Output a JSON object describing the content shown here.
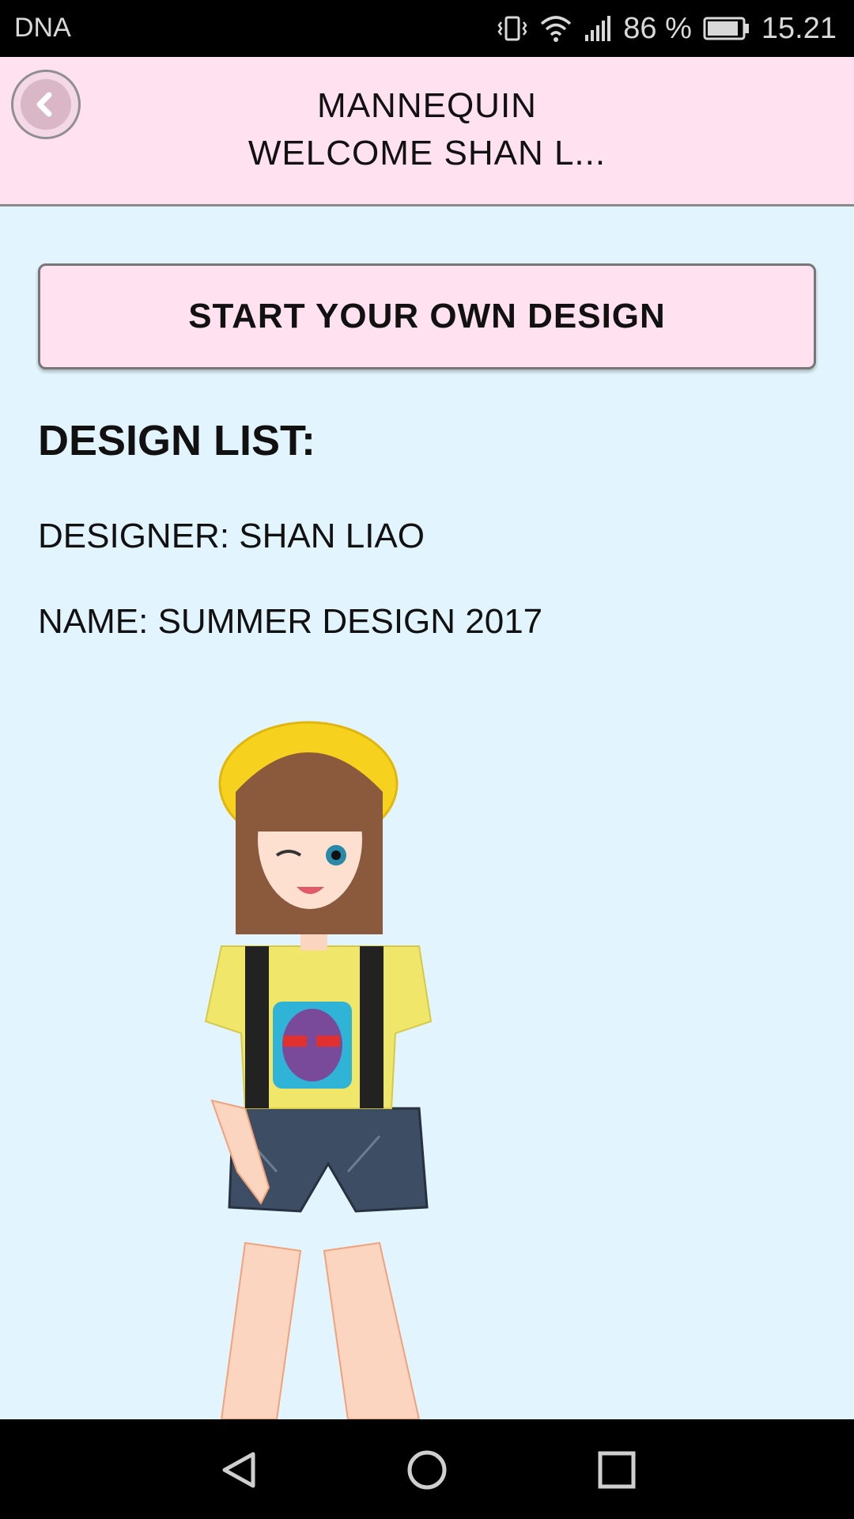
{
  "status_bar": {
    "carrier": "DNA",
    "battery": "86 %",
    "time": "15.21",
    "icons": [
      "vibrate-icon",
      "wifi-icon",
      "signal-icon",
      "battery-icon"
    ]
  },
  "header": {
    "title_line1": "MANNEQUIN",
    "title_line2": "WELCOME SHAN L...",
    "back_icon": "chevron-left-icon"
  },
  "main": {
    "start_button_label": "START YOUR OWN DESIGN",
    "section_title": "DESIGN LIST:",
    "designer": "DESIGNER: SHAN LIAO",
    "name": "NAME: SUMMER DESIGN 2017"
  },
  "nav_bar": {
    "icons": [
      "back-triangle-icon",
      "home-circle-icon",
      "recents-square-icon"
    ]
  },
  "colors": {
    "header_bg": "#ffe1ef",
    "page_bg": "#e2f4fd",
    "button_bg": "#ffe1ef"
  }
}
